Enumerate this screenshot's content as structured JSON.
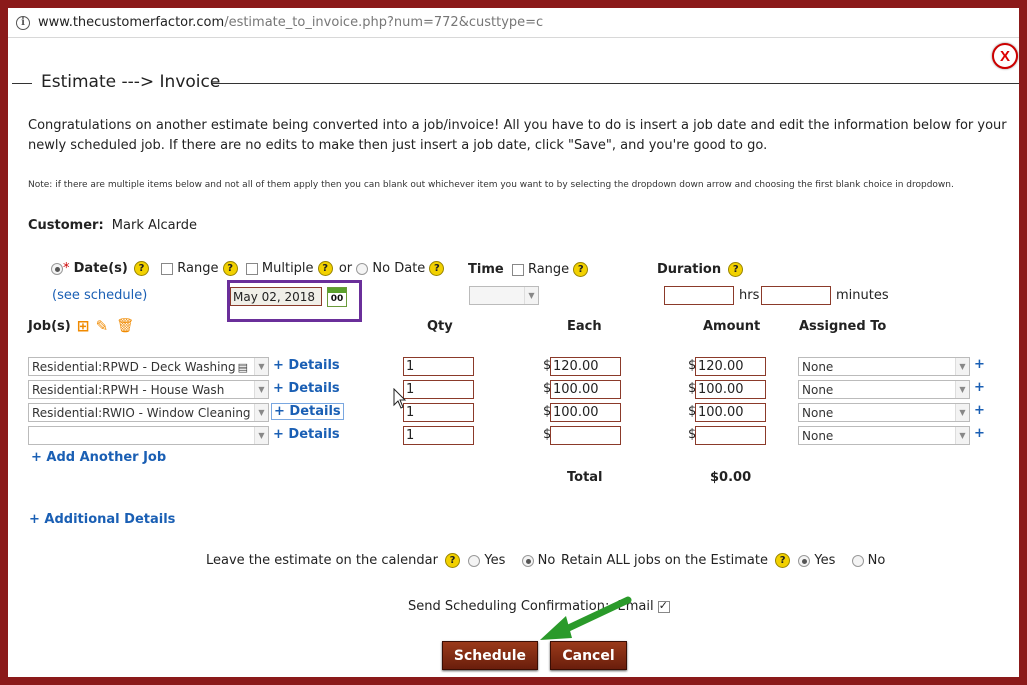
{
  "browser": {
    "url_host": "www.thecustomerfactor.com",
    "url_path": "/estimate_to_invoice.php?num=772&custtype=c"
  },
  "dialog": {
    "close_label": "X",
    "legend": "Estimate ---> Invoice",
    "intro": "Congratulations on another estimate being converted into a job/invoice! All you have to do is insert a job date and edit the information below for your newly scheduled job. If there are no edits to make then just insert a job date, click \"Save\", and you're good to go.",
    "note": "Note: if there are multiple items below and not all of them apply then you can blank out whichever item you want to by selecting the dropdown down arrow and choosing the first blank choice in dropdown."
  },
  "customer": {
    "label": "Customer:",
    "name": "Mark Alcarde"
  },
  "date": {
    "dates_label": "Date(s)",
    "required_mark": "*",
    "range_label": "Range",
    "multiple_label": "Multiple",
    "or_label": "or",
    "no_date_label": "No Date",
    "see_schedule_open": "(",
    "see_schedule_link": "see schedule",
    "see_schedule_close": ")",
    "value": "May 02, 2018",
    "calendar_icon_text": "00"
  },
  "time": {
    "label": "Time",
    "range_label": "Range",
    "value": ""
  },
  "duration": {
    "label": "Duration",
    "hrs_value": "",
    "hrs_label": "hrs",
    "min_value": "",
    "min_label": "minutes"
  },
  "jobs": {
    "label": "Job(s)",
    "headers": {
      "qty": "Qty",
      "each": "Each",
      "amount": "Amount",
      "assigned": "Assigned To"
    },
    "rows": [
      {
        "job": "Residential:RPWD - Deck Washing",
        "details": "+ Details",
        "qty": "1",
        "each": "120.00",
        "amount": "120.00",
        "assigned": "None"
      },
      {
        "job": "Residential:RPWH - House Wash",
        "details": "+ Details",
        "qty": "1",
        "each": "100.00",
        "amount": "100.00",
        "assigned": "None"
      },
      {
        "job": "Residential:RWIO - Window Cleaning",
        "details": "+ Details",
        "qty": "1",
        "each": "100.00",
        "amount": "100.00",
        "assigned": "None"
      },
      {
        "job": "",
        "details": "+ Details",
        "qty": "1",
        "each": "",
        "amount": "",
        "assigned": "None"
      }
    ],
    "currency": "$",
    "add_assignee": "+",
    "add_another": "+ Add Another Job",
    "total_label": "Total",
    "total_value": "$0.00",
    "additional_details": "+ Additional Details"
  },
  "options": {
    "leave_on_calendar": "Leave the estimate on the calendar",
    "retain_jobs": "Retain ALL jobs on the Estimate",
    "yes": "Yes",
    "no": "No",
    "send_confirmation": "Send Scheduling Confirmation:",
    "email_label": "Email"
  },
  "buttons": {
    "schedule": "Schedule",
    "cancel": "Cancel"
  },
  "colors": {
    "frame": "#8b1a1a",
    "link": "#1a5fb4",
    "highlight_box": "#6a2f9a",
    "arrow": "#2a9a2a",
    "button": "#7a2410"
  }
}
